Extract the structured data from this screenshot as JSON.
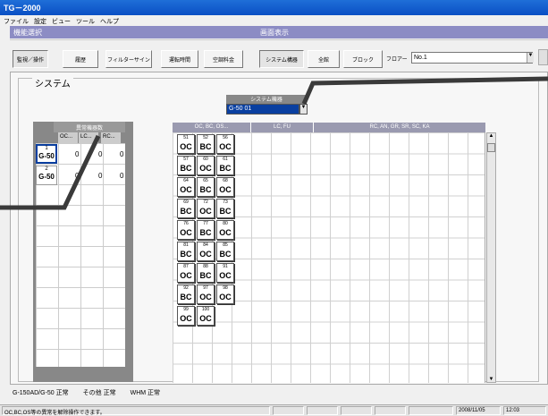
{
  "window": {
    "title": "TG－2000"
  },
  "menu": [
    "ファイル",
    "設定",
    "ビュー",
    "ツール",
    "ヘルプ"
  ],
  "groups": {
    "func": "機能選択",
    "screen": "画面表示"
  },
  "func_buttons": [
    "監視／操作",
    "履歴",
    "フィルターサイン",
    "運転時間",
    "空調料金"
  ],
  "screen_buttons": [
    "システム構器",
    "全館",
    "ブロック"
  ],
  "floor": {
    "label": "フロアー",
    "value": "No.1"
  },
  "panel": {
    "title": "システム"
  },
  "abnormal": {
    "header": "異常機器数",
    "columns": [
      "OC...",
      "LC...",
      "RC..."
    ],
    "rows": [
      {
        "num": "1",
        "name": "G-50",
        "oc": "0",
        "lc": "0",
        "rc": "0"
      },
      {
        "num": "2",
        "name": "G-50",
        "oc": "0",
        "lc": "0",
        "rc": "0"
      }
    ]
  },
  "system_device": {
    "label": "システム機器",
    "value": "G-50 01"
  },
  "right_headers": [
    "OC, BC, OS...",
    "LC, FU",
    "RC, AN, GR, SR, SC, KA"
  ],
  "devices": [
    [
      {
        "n": "51",
        "t": "OC"
      },
      {
        "n": "52",
        "t": "BC"
      },
      {
        "n": "56",
        "t": "OC"
      }
    ],
    [
      {
        "n": "57",
        "t": "BC"
      },
      {
        "n": "60",
        "t": "OC"
      },
      {
        "n": "61",
        "t": "BC"
      }
    ],
    [
      {
        "n": "64",
        "t": "OC"
      },
      {
        "n": "65",
        "t": "BC"
      },
      {
        "n": "68",
        "t": "OC"
      }
    ],
    [
      {
        "n": "69",
        "t": "BC"
      },
      {
        "n": "72",
        "t": "OC"
      },
      {
        "n": "73",
        "t": "BC"
      }
    ],
    [
      {
        "n": "76",
        "t": "OC"
      },
      {
        "n": "77",
        "t": "BC"
      },
      {
        "n": "80",
        "t": "OC"
      }
    ],
    [
      {
        "n": "81",
        "t": "BC"
      },
      {
        "n": "84",
        "t": "OC"
      },
      {
        "n": "85",
        "t": "BC"
      }
    ],
    [
      {
        "n": "87",
        "t": "OC"
      },
      {
        "n": "88",
        "t": "BC"
      },
      {
        "n": "91",
        "t": "OC"
      }
    ],
    [
      {
        "n": "92",
        "t": "BC"
      },
      {
        "n": "97",
        "t": "OC"
      },
      {
        "n": "98",
        "t": "OC"
      }
    ],
    [
      {
        "n": "99",
        "t": "OC"
      },
      {
        "n": "100",
        "t": "OC"
      }
    ]
  ],
  "status": {
    "g50": "G-150AD/G-50",
    "g50_state": "正常",
    "other": "その他",
    "other_state": "正常",
    "whm": "WHM",
    "whm_state": "正常"
  },
  "statusbar": {
    "message": "OC,BC,OS等の異常を解除操作できます。",
    "date": "2008/11/05",
    "time": "12:03"
  },
  "colors": {
    "titlebar": "#0a4fc4",
    "group_header": "#8c8cc4",
    "selected": "#0a3fa0"
  }
}
